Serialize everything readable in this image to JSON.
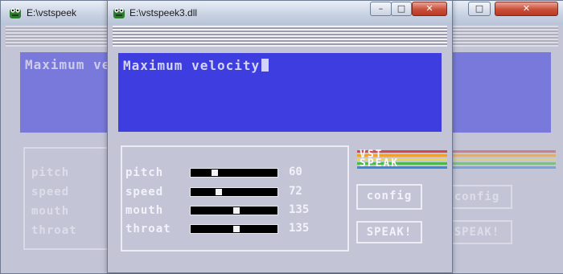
{
  "background_window": {
    "title": "E:\\vstspeek",
    "text": "Maximum velocity",
    "labels": [
      "pitch",
      "speed",
      "mouth",
      "throat"
    ],
    "config_label": "config",
    "speak_label": "SPEAK!"
  },
  "window": {
    "title": "E:\\vstspeek3.dll",
    "minimize_glyph": "–",
    "maximize_glyph": "□",
    "close_glyph": "✕"
  },
  "speech_text": "Maximum velocity",
  "sliders": [
    {
      "label": "pitch",
      "value": "60",
      "level": 0.28
    },
    {
      "label": "speed",
      "value": "72",
      "level": 0.32
    },
    {
      "label": "mouth",
      "value": "135",
      "level": 0.53
    },
    {
      "label": "throat",
      "value": "135",
      "level": 0.53
    }
  ],
  "logo": {
    "line1": "VST",
    "line2": "SPEAK",
    "colors": [
      "#d8454a",
      "#f0a02c",
      "#e8d84a",
      "#4cb84a",
      "#3b8ad8"
    ]
  },
  "buttons": {
    "config": "config",
    "speak": "SPEAK!"
  },
  "colors": {
    "display_bg": "#3d3de0",
    "window_bg": "#c3c4d6",
    "text": "#f2f2fa"
  },
  "icons": {
    "app": "frog-icon"
  }
}
